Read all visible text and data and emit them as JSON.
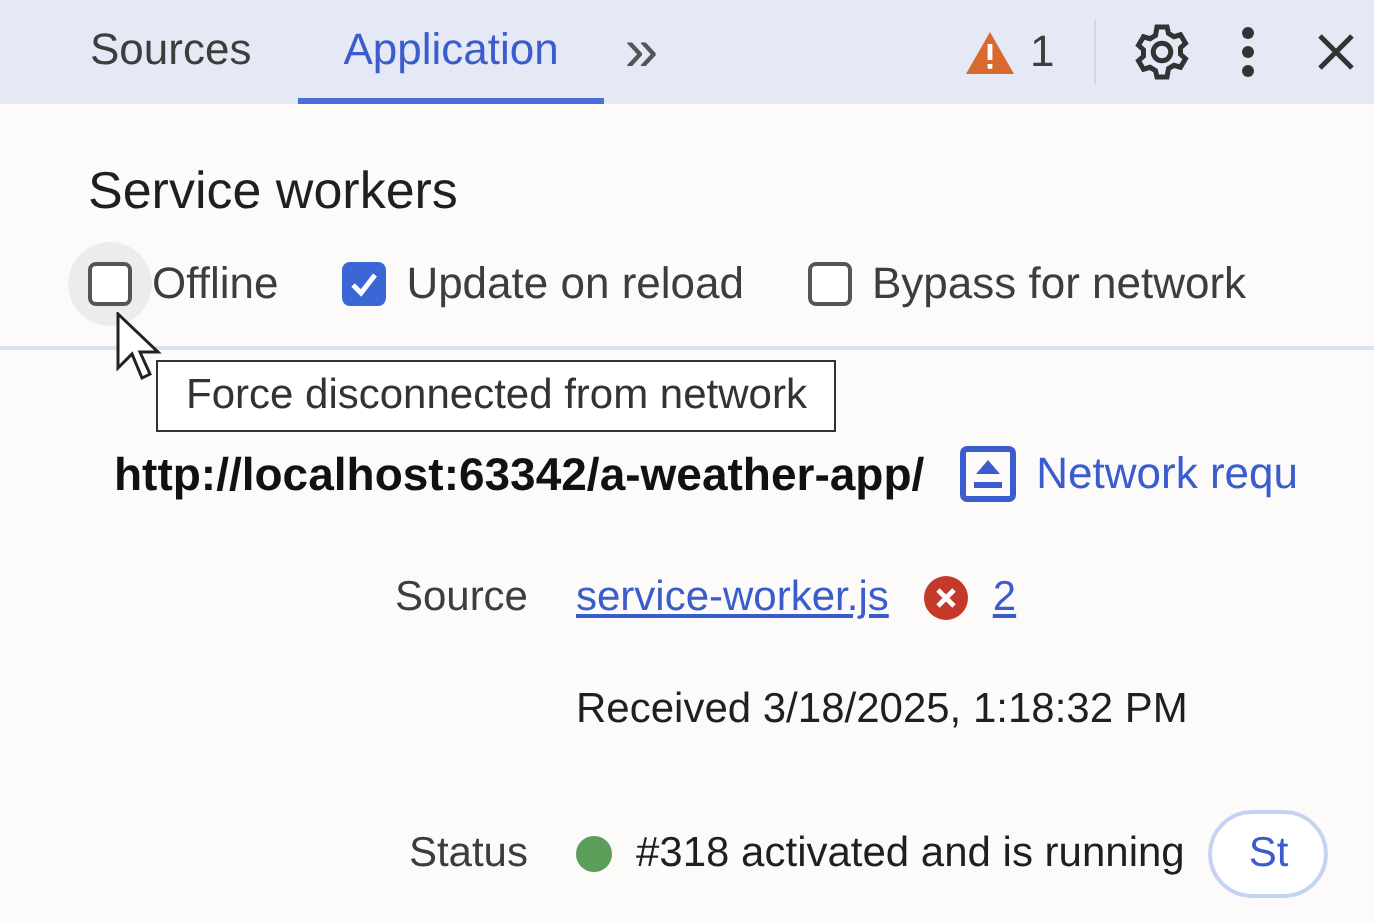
{
  "tabs": [
    {
      "label": "Sources",
      "selected": false
    },
    {
      "label": "Application",
      "selected": true
    }
  ],
  "more_tabs": "»",
  "warnings": {
    "count": "1"
  },
  "section": {
    "title": "Service workers",
    "options": [
      {
        "label": "Offline",
        "checked": false,
        "hovered": true
      },
      {
        "label": "Update on reload",
        "checked": true,
        "hovered": false
      },
      {
        "label": "Bypass for network",
        "checked": false,
        "hovered": false
      }
    ],
    "tooltip": "Force disconnected from network"
  },
  "worker": {
    "url": "http://localhost:63342/a-weather-app/",
    "network_link": "Network requ",
    "source_label": "Source",
    "source_file": "service-worker.js",
    "error_count": "2",
    "received": "Received 3/18/2025, 1:18:32 PM",
    "status_label": "Status",
    "status_text": "#318 activated and is running",
    "status_button": "St"
  }
}
